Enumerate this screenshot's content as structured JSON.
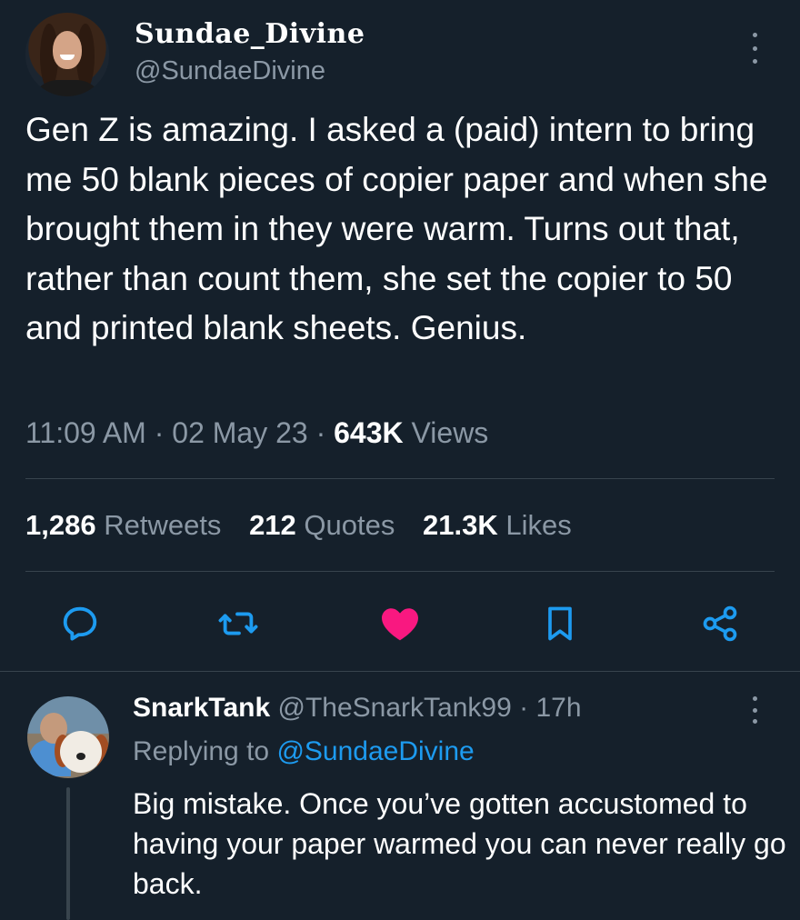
{
  "tweet": {
    "display_name": "Sundae_Divine",
    "handle": "@SundaeDivine",
    "text": "Gen Z is amazing. I asked a (paid) intern to bring me 50 blank pieces of copier paper and when she brought them in they were warm. Turns out that, rather than count them, she set the copier to 50 and printed blank sheets. Genius.",
    "time": "11:09 AM",
    "date": "02 May 23",
    "views_count": "643K",
    "views_label": "Views",
    "separator": "·"
  },
  "stats": [
    {
      "count": "1,286",
      "label": "Retweets"
    },
    {
      "count": "212",
      "label": "Quotes"
    },
    {
      "count": "21.3K",
      "label": "Likes"
    }
  ],
  "actions": {
    "reply_icon": "reply-icon",
    "retweet_icon": "retweet-icon",
    "like_icon": "heart-icon",
    "bookmark_icon": "bookmark-icon",
    "share_icon": "share-icon",
    "like_color": "#f91880",
    "icon_color": "#1d9bf0"
  },
  "reply": {
    "display_name": "SnarkTank",
    "handle": "@TheSnarkTank99",
    "separator": "·",
    "age": "17h",
    "replying_label": "Replying to",
    "replying_to": "@SundaeDivine",
    "text": "Big mistake. Once you’ve gotten accustomed to having your paper warmed you can never really go back."
  },
  "colors": {
    "background": "#15202b",
    "secondary_text": "#8b98a5",
    "link": "#1d9bf0",
    "divider": "#38444d"
  }
}
